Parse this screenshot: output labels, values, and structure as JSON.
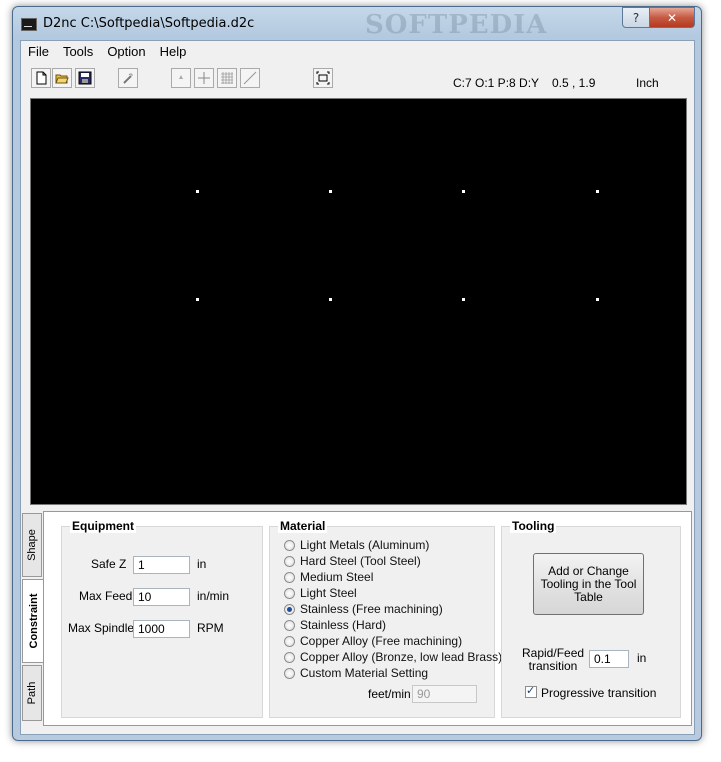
{
  "window": {
    "title": "D2nc C:\\Softpedia\\Softpedia.d2c",
    "watermark": "SOFTPEDIA",
    "buttons": {
      "help": "?",
      "minimize": "–",
      "maximize": "□",
      "close": "✕"
    }
  },
  "menu": [
    "File",
    "Tools",
    "Option",
    "Help"
  ],
  "toolbar": {
    "icons": [
      "new-file-icon",
      "open-folder-icon",
      "save-icon",
      "wand-icon",
      "point-icon",
      "crosshair-icon",
      "grid-icon",
      "line-icon",
      "fit-view-icon"
    ]
  },
  "status": {
    "counts": "C:7  O:1  P:8  D:Y",
    "coords": "0.5 , 1.9",
    "units": "Inch"
  },
  "side_tabs": {
    "shape": "Shape",
    "constraint": "Constraint",
    "path": "Path"
  },
  "equipment": {
    "title": "Equipment",
    "safe_z": {
      "label": "Safe Z",
      "value": "1",
      "unit": "in"
    },
    "max_feed": {
      "label": "Max Feed",
      "value": "10",
      "unit": "in/min"
    },
    "max_spindle": {
      "label": "Max Spindle",
      "value": "1000",
      "unit": "RPM"
    }
  },
  "material": {
    "title": "Material",
    "options": [
      {
        "label": "Light Metals (Aluminum)",
        "selected": false
      },
      {
        "label": "Hard Steel (Tool Steel)",
        "selected": false
      },
      {
        "label": "Medium Steel",
        "selected": false
      },
      {
        "label": "Light Steel",
        "selected": false
      },
      {
        "label": "Stainless (Free machining)",
        "selected": true
      },
      {
        "label": "Stainless (Hard)",
        "selected": false
      },
      {
        "label": "Copper Alloy (Free machining)",
        "selected": false
      },
      {
        "label": "Copper Alloy (Bronze, low lead Brass)",
        "selected": false
      },
      {
        "label": "Custom Material Setting",
        "selected": false
      }
    ],
    "speed_label": "feet/min",
    "speed_value": "90"
  },
  "tooling": {
    "title": "Tooling",
    "change_button": "Add or Change Tooling in the Tool Table",
    "rapid_label": "Rapid/Feed transition",
    "rapid_value": "0.1",
    "rapid_unit": "in",
    "progressive_label": "Progressive transition",
    "progressive_checked": true
  }
}
